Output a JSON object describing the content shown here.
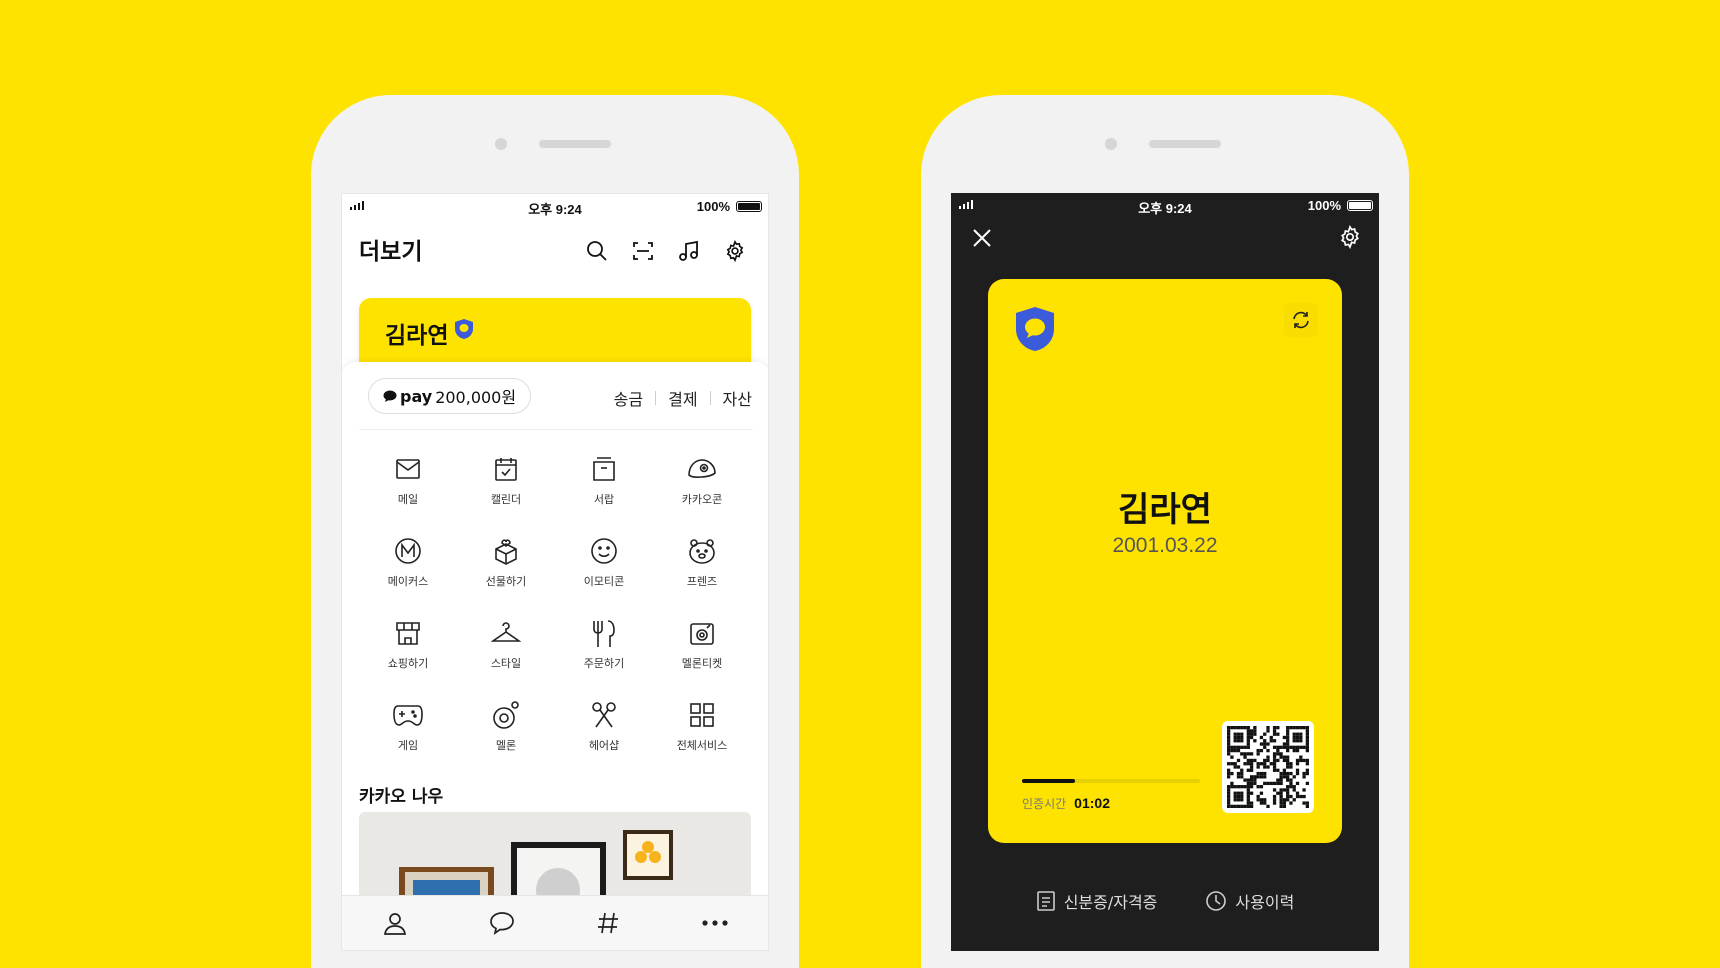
{
  "colors": {
    "background": "#FFE300",
    "accent": "#FFE300",
    "shield": "#3B5BDB",
    "dark_screen": "#1e1e1e"
  },
  "status_bar": {
    "time": "오후 9:24",
    "battery": "100%"
  },
  "left_screen": {
    "title": "더보기",
    "header_icons": [
      "search-icon",
      "scan-icon",
      "music-icon",
      "gear-icon"
    ],
    "profile": {
      "name": "김라연",
      "badge_icon": "shield-icon"
    },
    "pay": {
      "logo": "pay",
      "amount": "200,000원",
      "links": [
        "송금",
        "결제",
        "자산"
      ]
    },
    "grid": [
      {
        "label": "메일",
        "icon": "mail-icon"
      },
      {
        "label": "캘린더",
        "icon": "calendar-icon"
      },
      {
        "label": "서랍",
        "icon": "drawer-icon"
      },
      {
        "label": "카카오콘",
        "icon": "kakaocon-icon"
      },
      {
        "label": "메이커스",
        "icon": "makers-icon"
      },
      {
        "label": "선물하기",
        "icon": "gift-icon"
      },
      {
        "label": "이모티콘",
        "icon": "emoticon-icon"
      },
      {
        "label": "프렌즈",
        "icon": "friends-icon"
      },
      {
        "label": "쇼핑하기",
        "icon": "shop-icon"
      },
      {
        "label": "스타일",
        "icon": "hanger-icon"
      },
      {
        "label": "주문하기",
        "icon": "fork-knife-icon"
      },
      {
        "label": "멜론티켓",
        "icon": "ticket-icon"
      },
      {
        "label": "게임",
        "icon": "gamepad-icon"
      },
      {
        "label": "멜론",
        "icon": "melon-icon"
      },
      {
        "label": "헤어샵",
        "icon": "scissors-icon"
      },
      {
        "label": "전체서비스",
        "icon": "grid-icon"
      }
    ],
    "kakao_now_title": "카카오 나우",
    "tabs": [
      "person-icon",
      "chat-icon",
      "hashtag-icon",
      "more-icon"
    ]
  },
  "right_screen": {
    "card": {
      "name": "김라연",
      "birthdate": "2001.03.22",
      "timer_label": "인증시간",
      "timer_value": "01:02",
      "timer_progress": 0.3
    },
    "bottom_links": [
      {
        "label": "신분증/자격증",
        "icon": "document-icon"
      },
      {
        "label": "사용이력",
        "icon": "clock-icon"
      }
    ]
  }
}
